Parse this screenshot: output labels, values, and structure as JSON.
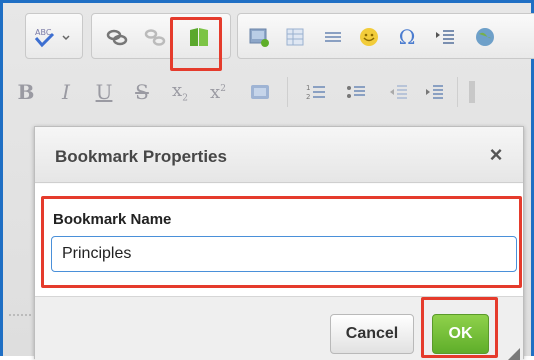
{
  "toolbar": {
    "row1": [
      "spell-check",
      "link",
      "unlink",
      "bookmark",
      "image",
      "table",
      "horizontal-rule",
      "smiley",
      "special-character",
      "page-break",
      "iframe"
    ],
    "row2": {
      "bold": "B",
      "italic": "I",
      "underline": "U",
      "strike": "S",
      "subscript": "x",
      "superscript": "x",
      "sub_suffix": "2",
      "sup_suffix": "2"
    }
  },
  "dialog": {
    "title": "Bookmark Properties",
    "close_symbol": "×",
    "field_label": "Bookmark Name",
    "field_value": "Principles",
    "cancel_label": "Cancel",
    "ok_label": "OK"
  },
  "colors": {
    "highlight": "#e53b2c",
    "frame": "#1f6fc4",
    "ok_green": "#6fbf33"
  }
}
